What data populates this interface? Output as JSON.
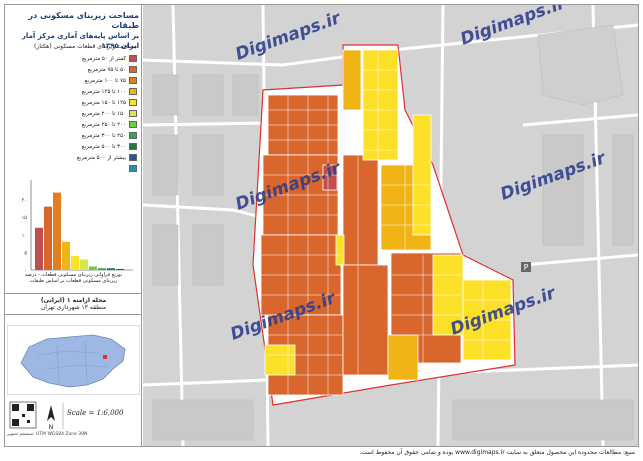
{
  "sidebar": {
    "title_line1": "مساحت زیربنای مسکونی در طبقات",
    "title_line2": "بر اساس پایه‌های آماری مرکز آمار ایران ۱۳۹۵",
    "legend_title": "مساحت زیربنای قطعات مسکونی (هکتار)",
    "legend": [
      {
        "label": "کمتر از ۵۰ مترمربع",
        "color": "#c0504d"
      },
      {
        "label": "۵۰ تا ۷۵ مترمربع",
        "color": "#d9662d"
      },
      {
        "label": "۷۵ تا ۱۰۰ مترمربع",
        "color": "#e37f1e"
      },
      {
        "label": "۱۰۰ تا ۱۲۵ مترمربع",
        "color": "#f0b416"
      },
      {
        "label": "۱۲۵ تا ۱۵۰ مترمربع",
        "color": "#fde128"
      },
      {
        "label": "۱۵۰ تا ۲۰۰ مترمربع",
        "color": "#d6e84a"
      },
      {
        "label": "۲۰۰ تا ۲۵۰ مترمربع",
        "color": "#6ccf3f"
      },
      {
        "label": "۲۵۰ تا ۳۰۰ مترمربع",
        "color": "#2fa84a"
      },
      {
        "label": "۳۰۰ تا ۵۰۰ مترمربع",
        "color": "#1f7a4a"
      },
      {
        "label": "بیشتر از ۵۰۰ مترمربع",
        "color": "#1f5f8f"
      },
      {
        "label": "",
        "color": "#2b8fb0"
      }
    ],
    "chart_axis_ticks": [
      "۰",
      "۵",
      "۱۰",
      "۱۵",
      "۲۰"
    ],
    "chart_caption": "توزیع فراوانی زیربنای مسکونی قطعات - درصد",
    "chart_caption2": "زیربنای مسکونی قطعات بر اساس طبقات",
    "neighborhood": "محله ارامنه ۱ (ایرانی)",
    "district": "منطقه ۱۳ شهرداری تهران",
    "scale": "Scale = 1:6,000",
    "source_line": "سیستم تصویر: UTM WGS84 Zone 39N"
  },
  "map": {
    "watermark": "Digimaps.ir",
    "parking_label": "P"
  },
  "footer": {
    "text": "منبع: مطالعات محدوده این محصول متعلق به سایت www.digimaps.ir بوده و تمامی حقوق آن محفوظ است."
  },
  "chart_data": {
    "type": "bar",
    "categories": [
      "<50",
      "50-75",
      "75-100",
      "100-125",
      "125-150",
      "150-200",
      "200-250",
      "250-300",
      "300-500",
      ">500"
    ],
    "values": [
      12,
      18,
      22,
      8,
      4,
      3,
      1,
      0.5,
      0.5,
      0.3
    ],
    "colors": [
      "#c0504d",
      "#d9662d",
      "#e37f1e",
      "#f0b416",
      "#fde128",
      "#d6e84a",
      "#6ccf3f",
      "#2fa84a",
      "#1f7a4a",
      "#1f5f8f"
    ],
    "ylim": [
      0,
      25
    ]
  }
}
